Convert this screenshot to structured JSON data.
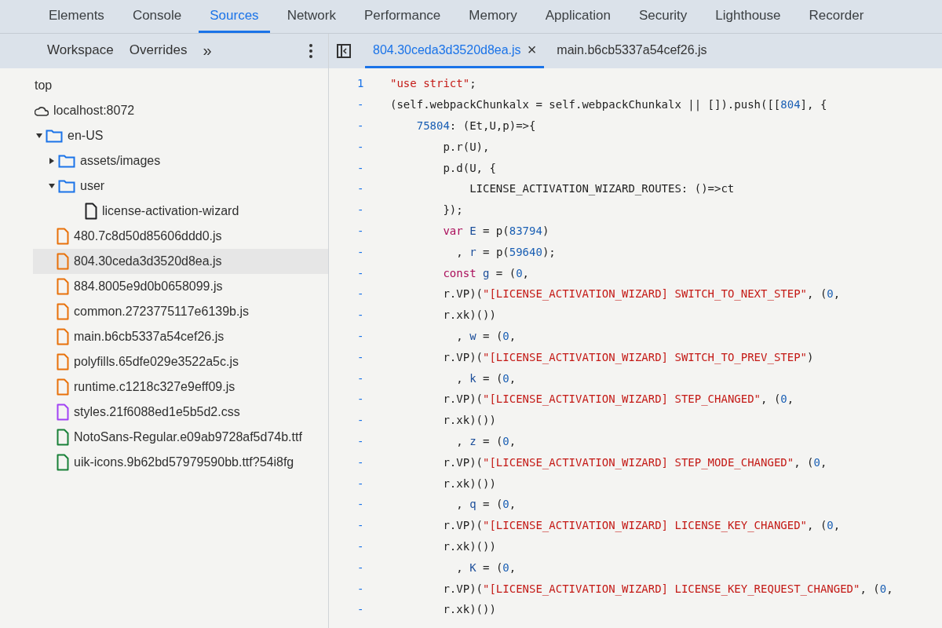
{
  "panel_tabs": [
    {
      "label": "Elements",
      "selected": false
    },
    {
      "label": "Console",
      "selected": false
    },
    {
      "label": "Sources",
      "selected": true
    },
    {
      "label": "Network",
      "selected": false
    },
    {
      "label": "Performance",
      "selected": false
    },
    {
      "label": "Memory",
      "selected": false
    },
    {
      "label": "Application",
      "selected": false
    },
    {
      "label": "Security",
      "selected": false
    },
    {
      "label": "Lighthouse",
      "selected": false
    },
    {
      "label": "Recorder",
      "selected": false
    }
  ],
  "navigator": {
    "tabs": [
      {
        "label": "Workspace",
        "selected": false
      },
      {
        "label": "Overrides",
        "selected": false
      }
    ],
    "more": "»",
    "tree": [
      {
        "label": "top",
        "selected": false,
        "children": [
          {
            "label": "localhost:8072",
            "kind": "origin",
            "selected": false,
            "children": [
              {
                "label": "en-US",
                "kind": "folder",
                "expanded": true,
                "selected": false,
                "children": [
                  {
                    "label": "assets/images",
                    "kind": "folder",
                    "expanded": false,
                    "selected": false
                  },
                  {
                    "label": "user",
                    "kind": "folder",
                    "expanded": true,
                    "selected": false,
                    "children": [
                      {
                        "label": "license-activation-wizard",
                        "kind": "document",
                        "selected": false
                      }
                    ]
                  },
                  {
                    "label": "480.7c8d50d85606ddd0.js",
                    "kind": "script",
                    "selected": false
                  },
                  {
                    "label": "804.30ceda3d3520d8ea.js",
                    "kind": "script",
                    "selected": true
                  },
                  {
                    "label": "884.8005e9d0b0658099.js",
                    "kind": "script",
                    "selected": false
                  },
                  {
                    "label": "common.2723775117e6139b.js",
                    "kind": "script",
                    "selected": false
                  },
                  {
                    "label": "main.b6cb5337a54cef26.js",
                    "kind": "script",
                    "selected": false
                  },
                  {
                    "label": "polyfills.65dfe029e3522a5c.js",
                    "kind": "script",
                    "selected": false
                  },
                  {
                    "label": "runtime.c1218c327e9eff09.js",
                    "kind": "script",
                    "selected": false
                  },
                  {
                    "label": "styles.21f6088ed1e5b5d2.css",
                    "kind": "stylesheet",
                    "selected": false
                  },
                  {
                    "label": "NotoSans-Regular.e09ab9728af5d74b.ttf",
                    "kind": "font",
                    "selected": false
                  },
                  {
                    "label": "uik-icons.9b62bd57979590bb.ttf?54i8fg",
                    "kind": "font",
                    "selected": false
                  }
                ]
              }
            ]
          }
        ]
      }
    ]
  },
  "editor": {
    "tabs": [
      {
        "label": "804.30ceda3d3520d8ea.js",
        "selected": true,
        "close": "×"
      },
      {
        "label": "main.b6cb5337a54cef26.js",
        "selected": false
      }
    ],
    "lines": [
      {
        "number": "1",
        "tokens": [
          {
            "kind": "str",
            "text": "\"use strict\""
          },
          {
            "kind": "plain",
            "text": ";"
          }
        ]
      },
      {
        "number": "-",
        "tokens": [
          {
            "kind": "plain",
            "text": "(self.webpackChunkalx = self.webpackChunkalx || []).push([["
          },
          {
            "kind": "num",
            "text": "804"
          },
          {
            "kind": "plain",
            "text": "], {"
          }
        ]
      },
      {
        "number": "-",
        "tokens": [
          {
            "kind": "num",
            "text": "    75804"
          },
          {
            "kind": "plain",
            "text": ": (Et,U,p)=>{"
          }
        ]
      },
      {
        "number": "-",
        "tokens": [
          {
            "kind": "plain",
            "text": "        p.r(U),"
          }
        ]
      },
      {
        "number": "-",
        "tokens": [
          {
            "kind": "plain",
            "text": "        p.d(U, {"
          }
        ]
      },
      {
        "number": "-",
        "tokens": [
          {
            "kind": "plain",
            "text": "            LICENSE_ACTIVATION_WIZARD_ROUTES: ()=>ct"
          }
        ]
      },
      {
        "number": "-",
        "tokens": [
          {
            "kind": "plain",
            "text": "        });"
          }
        ]
      },
      {
        "number": "-",
        "tokens": [
          {
            "kind": "kw",
            "text": "        var"
          },
          {
            "kind": "var",
            "text": " E"
          },
          {
            "kind": "plain",
            "text": " = p("
          },
          {
            "kind": "num",
            "text": "83794"
          },
          {
            "kind": "plain",
            "text": ")"
          }
        ]
      },
      {
        "number": "-",
        "tokens": [
          {
            "kind": "plain",
            "text": "          , "
          },
          {
            "kind": "var",
            "text": "r"
          },
          {
            "kind": "plain",
            "text": " = p("
          },
          {
            "kind": "num",
            "text": "59640"
          },
          {
            "kind": "plain",
            "text": ");"
          }
        ]
      },
      {
        "number": "-",
        "tokens": [
          {
            "kind": "kw",
            "text": "        const"
          },
          {
            "kind": "var",
            "text": " g"
          },
          {
            "kind": "plain",
            "text": " = ("
          },
          {
            "kind": "num",
            "text": "0"
          },
          {
            "kind": "plain",
            "text": ","
          }
        ]
      },
      {
        "number": "-",
        "tokens": [
          {
            "kind": "plain",
            "text": "        r.VP)("
          },
          {
            "kind": "str",
            "text": "\"[LICENSE_ACTIVATION_WIZARD] SWITCH_TO_NEXT_STEP\""
          },
          {
            "kind": "plain",
            "text": ", ("
          },
          {
            "kind": "num",
            "text": "0"
          },
          {
            "kind": "plain",
            "text": ","
          }
        ]
      },
      {
        "number": "-",
        "tokens": [
          {
            "kind": "plain",
            "text": "        r.xk)())"
          }
        ]
      },
      {
        "number": "-",
        "tokens": [
          {
            "kind": "plain",
            "text": "          , "
          },
          {
            "kind": "var",
            "text": "w"
          },
          {
            "kind": "plain",
            "text": " = ("
          },
          {
            "kind": "num",
            "text": "0"
          },
          {
            "kind": "plain",
            "text": ","
          }
        ]
      },
      {
        "number": "-",
        "tokens": [
          {
            "kind": "plain",
            "text": "        r.VP)("
          },
          {
            "kind": "str",
            "text": "\"[LICENSE_ACTIVATION_WIZARD] SWITCH_TO_PREV_STEP\""
          },
          {
            "kind": "plain",
            "text": ")"
          }
        ]
      },
      {
        "number": "-",
        "tokens": [
          {
            "kind": "plain",
            "text": "          , "
          },
          {
            "kind": "var",
            "text": "k"
          },
          {
            "kind": "plain",
            "text": " = ("
          },
          {
            "kind": "num",
            "text": "0"
          },
          {
            "kind": "plain",
            "text": ","
          }
        ]
      },
      {
        "number": "-",
        "tokens": [
          {
            "kind": "plain",
            "text": "        r.VP)("
          },
          {
            "kind": "str",
            "text": "\"[LICENSE_ACTIVATION_WIZARD] STEP_CHANGED\""
          },
          {
            "kind": "plain",
            "text": ", ("
          },
          {
            "kind": "num",
            "text": "0"
          },
          {
            "kind": "plain",
            "text": ","
          }
        ]
      },
      {
        "number": "-",
        "tokens": [
          {
            "kind": "plain",
            "text": "        r.xk)())"
          }
        ]
      },
      {
        "number": "-",
        "tokens": [
          {
            "kind": "plain",
            "text": "          , "
          },
          {
            "kind": "var",
            "text": "z"
          },
          {
            "kind": "plain",
            "text": " = ("
          },
          {
            "kind": "num",
            "text": "0"
          },
          {
            "kind": "plain",
            "text": ","
          }
        ]
      },
      {
        "number": "-",
        "tokens": [
          {
            "kind": "plain",
            "text": "        r.VP)("
          },
          {
            "kind": "str",
            "text": "\"[LICENSE_ACTIVATION_WIZARD] STEP_MODE_CHANGED\""
          },
          {
            "kind": "plain",
            "text": ", ("
          },
          {
            "kind": "num",
            "text": "0"
          },
          {
            "kind": "plain",
            "text": ","
          }
        ]
      },
      {
        "number": "-",
        "tokens": [
          {
            "kind": "plain",
            "text": "        r.xk)())"
          }
        ]
      },
      {
        "number": "-",
        "tokens": [
          {
            "kind": "plain",
            "text": "          , "
          },
          {
            "kind": "var",
            "text": "q"
          },
          {
            "kind": "plain",
            "text": " = ("
          },
          {
            "kind": "num",
            "text": "0"
          },
          {
            "kind": "plain",
            "text": ","
          }
        ]
      },
      {
        "number": "-",
        "tokens": [
          {
            "kind": "plain",
            "text": "        r.VP)("
          },
          {
            "kind": "str",
            "text": "\"[LICENSE_ACTIVATION_WIZARD] LICENSE_KEY_CHANGED\""
          },
          {
            "kind": "plain",
            "text": ", ("
          },
          {
            "kind": "num",
            "text": "0"
          },
          {
            "kind": "plain",
            "text": ","
          }
        ]
      },
      {
        "number": "-",
        "tokens": [
          {
            "kind": "plain",
            "text": "        r.xk)())"
          }
        ]
      },
      {
        "number": "-",
        "tokens": [
          {
            "kind": "plain",
            "text": "          , "
          },
          {
            "kind": "var",
            "text": "K"
          },
          {
            "kind": "plain",
            "text": " = ("
          },
          {
            "kind": "num",
            "text": "0"
          },
          {
            "kind": "plain",
            "text": ","
          }
        ]
      },
      {
        "number": "-",
        "tokens": [
          {
            "kind": "plain",
            "text": "        r.VP)("
          },
          {
            "kind": "str",
            "text": "\"[LICENSE_ACTIVATION_WIZARD] LICENSE_KEY_REQUEST_CHANGED\""
          },
          {
            "kind": "plain",
            "text": ", ("
          },
          {
            "kind": "num",
            "text": "0"
          },
          {
            "kind": "plain",
            "text": ","
          }
        ]
      },
      {
        "number": "-",
        "tokens": [
          {
            "kind": "plain",
            "text": "        r.xk)())"
          }
        ]
      }
    ]
  }
}
